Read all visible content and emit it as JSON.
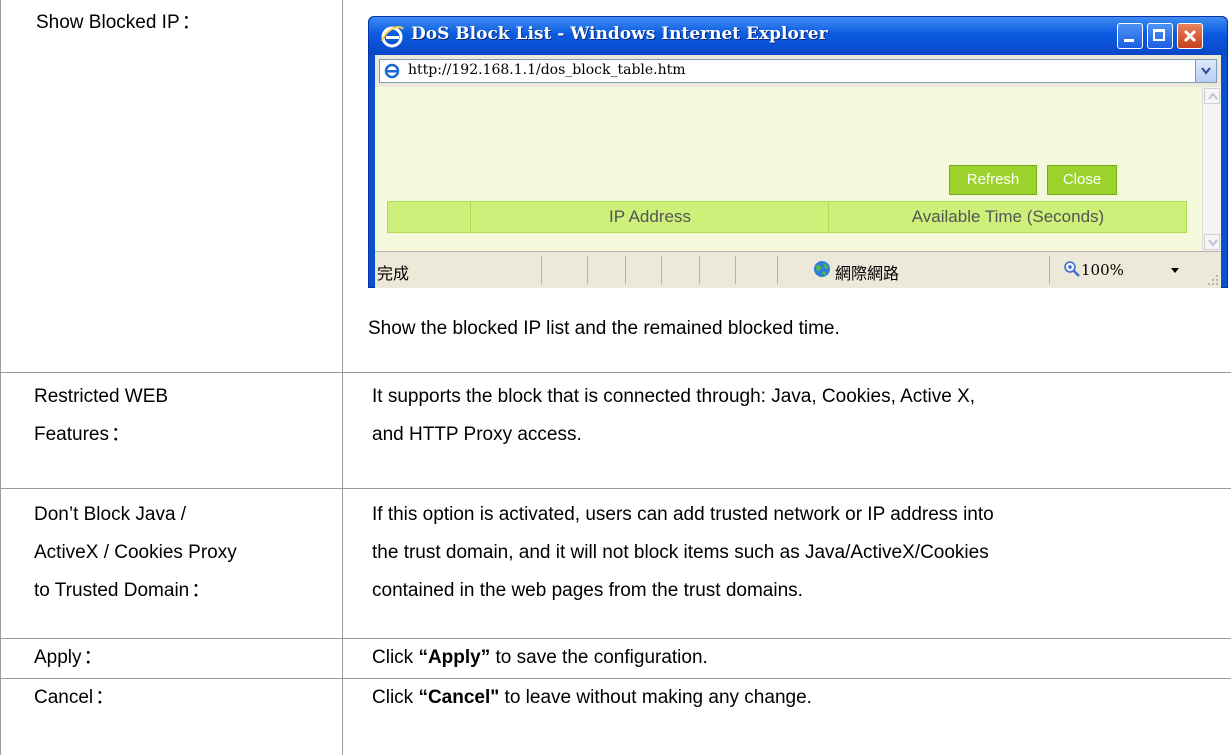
{
  "rows": [
    {
      "label": "Show Blocked IP",
      "colon": "：",
      "description": "Show the blocked IP list and the remained blocked time."
    },
    {
      "label_lines": [
        "Restricted WEB",
        "Features"
      ],
      "colon": "：",
      "description_lines": [
        "It supports the block that is connected through: Java, Cookies, Active X,",
        "and HTTP Proxy access."
      ]
    },
    {
      "label_lines": [
        "Don’t Block Java /",
        "ActiveX / Cookies Proxy",
        "to Trusted Domain"
      ],
      "colon": "：",
      "description_lines": [
        "If this option is activated, users can add trusted network or IP address into",
        "the trust domain, and it will not block items such as Java/ActiveX/Cookies",
        "contained in the web pages from the trust domains."
      ]
    },
    {
      "label": "Apply",
      "colon": "：",
      "desc_prefix": "Click ",
      "desc_bold": "“Apply”",
      "desc_suffix": " to save the configuration."
    },
    {
      "label": "Cancel",
      "colon": "：",
      "desc_prefix": "Click ",
      "desc_bold": "“Cancel\"",
      "desc_suffix": " to leave without making any change."
    }
  ],
  "popup": {
    "title": "DoS Block List - Windows Internet Explorer",
    "url": "http://192.168.1.1/dos_block_table.htm",
    "refresh_label": "Refresh",
    "close_label": "Close",
    "columns": [
      "",
      "IP Address",
      "Available Time (Seconds)"
    ],
    "status_text": "完成",
    "zone_text": "網際網路",
    "zoom_text": "100%",
    "colors": {
      "button_green": "#9bd22c",
      "header_green": "#ccf07a",
      "content_bg": "#f4f9db",
      "titlebar_blue": "#0b5be0"
    },
    "icons": [
      "ie-logo-icon",
      "minimize-icon",
      "maximize-icon",
      "close-icon",
      "page-icon",
      "dropdown-arrow-icon",
      "scroll-up-icon",
      "scroll-down-icon",
      "globe-icon",
      "zoom-icon"
    ]
  }
}
